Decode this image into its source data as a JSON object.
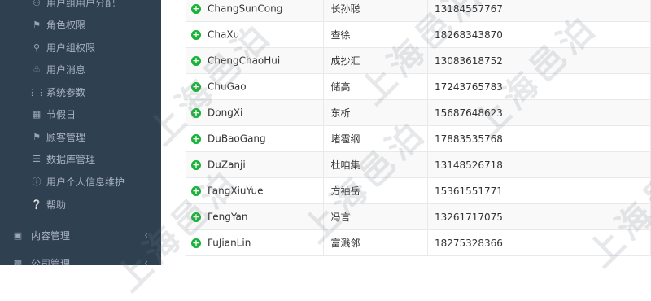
{
  "sidebar": {
    "items": [
      {
        "label": "用户组用户分配",
        "icon": "users-icon"
      },
      {
        "label": "角色权限",
        "icon": "flag-icon"
      },
      {
        "label": "用户组权限",
        "icon": "key-icon"
      },
      {
        "label": "用户消息",
        "icon": "bell-icon"
      },
      {
        "label": "系统参数",
        "icon": "sliders-icon"
      },
      {
        "label": "节假日",
        "icon": "calendar-icon"
      },
      {
        "label": "顾客管理",
        "icon": "flag-icon"
      },
      {
        "label": "数据库管理",
        "icon": "database-icon"
      },
      {
        "label": "用户个人信息维护",
        "icon": "info-icon"
      },
      {
        "label": "帮助",
        "icon": "help-icon"
      }
    ],
    "sections": [
      {
        "label": "内容管理",
        "icon": "picture-icon",
        "chevron": "‹"
      },
      {
        "label": "公司管理",
        "icon": "building-icon",
        "chevron": "‹"
      }
    ]
  },
  "table": {
    "rows": [
      {
        "login": "ChangSunCong",
        "name": "长孙聪",
        "phone": "13184557767"
      },
      {
        "login": "ChaXu",
        "name": "查徐",
        "phone": "18268343870"
      },
      {
        "login": "ChengChaoHui",
        "name": "成抄汇",
        "phone": "13083618752"
      },
      {
        "login": "ChuGao",
        "name": "储高",
        "phone": "17243765783"
      },
      {
        "login": "DongXi",
        "name": "东析",
        "phone": "15687648623"
      },
      {
        "login": "DuBaoGang",
        "name": "堵雹纲",
        "phone": "17883535768"
      },
      {
        "login": "DuZanji",
        "name": "杜咱集",
        "phone": "13148526718"
      },
      {
        "login": "FangXiuYue",
        "name": "方袖岳",
        "phone": "15361551771"
      },
      {
        "login": "FengYan",
        "name": "冯言",
        "phone": "13261717075"
      },
      {
        "login": "FuJianLin",
        "name": "富溅邻",
        "phone": "18275328366"
      }
    ]
  },
  "watermark": {
    "text": "上海邑泊"
  },
  "colors": {
    "sidebar_bg": "#2f4050",
    "add_icon": "#1ab23a"
  }
}
